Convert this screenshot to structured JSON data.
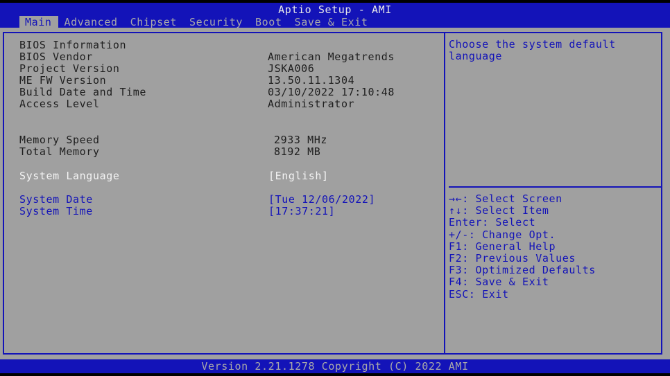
{
  "header": {
    "title": "Aptio Setup - AMI",
    "tabs": [
      "Main",
      "Advanced",
      "Chipset",
      "Security",
      "Boot",
      "Save & Exit"
    ]
  },
  "info": {
    "section_title": "BIOS Information",
    "rows": [
      {
        "label": "BIOS Vendor",
        "value": "American Megatrends"
      },
      {
        "label": "Project Version",
        "value": "JSKA006"
      },
      {
        "label": "ME FW Version",
        "value": "13.50.11.1304"
      },
      {
        "label": "Build Date and Time",
        "value": "03/10/2022 17:10:48"
      },
      {
        "label": "Access Level",
        "value": "Administrator"
      }
    ],
    "memory": [
      {
        "label": "Memory Speed",
        "value": "2933 MHz"
      },
      {
        "label": "Total Memory",
        "value": "8192 MB"
      }
    ]
  },
  "settings": {
    "language": {
      "label": "System Language",
      "value": "[English]"
    },
    "date": {
      "label": "System Date",
      "value": "[Tue 12/06/2022]"
    },
    "time": {
      "label": "System Time",
      "value": "[17:37:21]"
    }
  },
  "help": {
    "text": "Choose the system default language",
    "keys": [
      "→←: Select Screen",
      "↑↓: Select Item",
      "Enter: Select",
      "+/-: Change Opt.",
      "F1: General Help",
      "F2: Previous Values",
      "F3: Optimized Defaults",
      "F4: Save & Exit",
      "ESC: Exit"
    ]
  },
  "footer": {
    "text": "Version 2.21.1278 Copyright (C) 2022 AMI"
  },
  "colors": {
    "bios_blue": "#1313b8",
    "panel_gray": "#a0a0a0",
    "selected_text": "#f4f4f4"
  }
}
